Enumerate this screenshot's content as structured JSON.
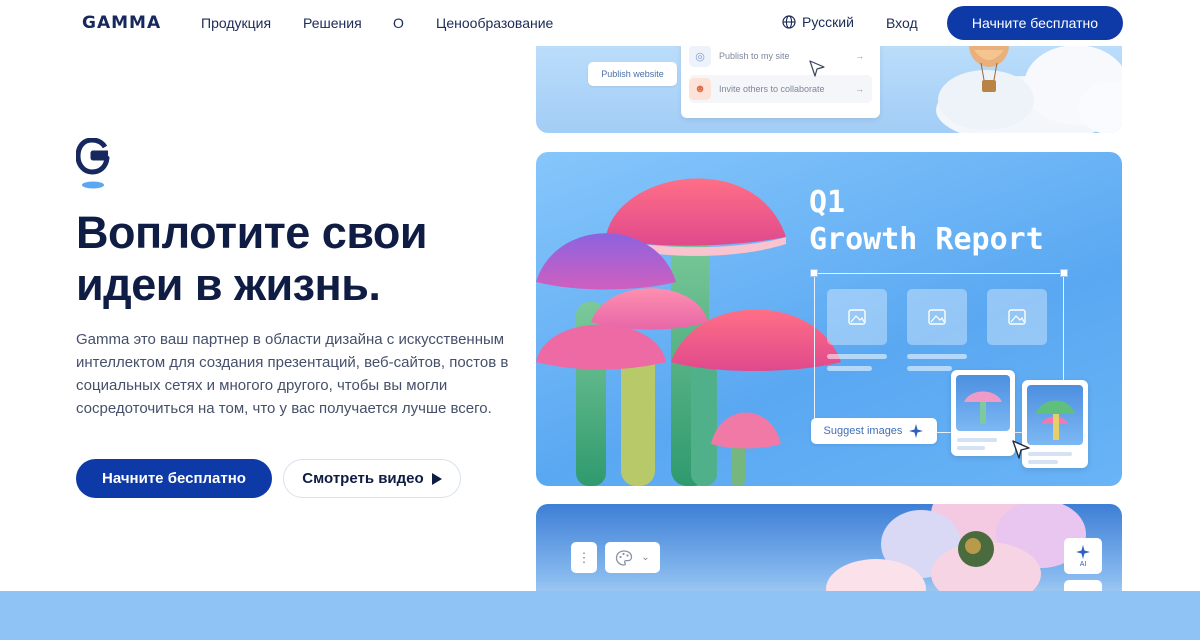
{
  "header": {
    "logo": "GAMMA",
    "nav": [
      "Продукция",
      "Решения",
      "О",
      "Ценообразование"
    ],
    "language": "Русский",
    "login": "Вход",
    "cta": "Начните бесплатно"
  },
  "hero": {
    "headline_line1": "Воплотите свои",
    "headline_line2": "идеи в жизнь.",
    "description": "Gamma это ваш партнер в области дизайна с искусственным интеллектом для создания презентаций, веб-сайтов, постов в социальных сетях и многого другого, чтобы вы могли сосредоточиться на том, что у вас получается лучше всего.",
    "primary_button": "Начните бесплатно",
    "secondary_button": "Смотреть видео"
  },
  "card1": {
    "publish_button": "Publish website",
    "share_items": [
      "Publish to my site",
      "Invite others to collaborate"
    ]
  },
  "card2": {
    "title_line1": "Q1",
    "title_line2": "Growth Report",
    "suggest_button": "Suggest images"
  },
  "card3": {
    "ai_badge": "AI"
  },
  "icons": {
    "globe": "globe-icon",
    "play": "play-icon",
    "cursor": "cursor-icon",
    "sparkle": "sparkle-icon",
    "palette": "palette-icon",
    "more": "more-vertical-icon"
  },
  "colors": {
    "brand": "#0d3aa6",
    "headline": "#0f1c43",
    "accent_pink": "#f06a8e"
  }
}
